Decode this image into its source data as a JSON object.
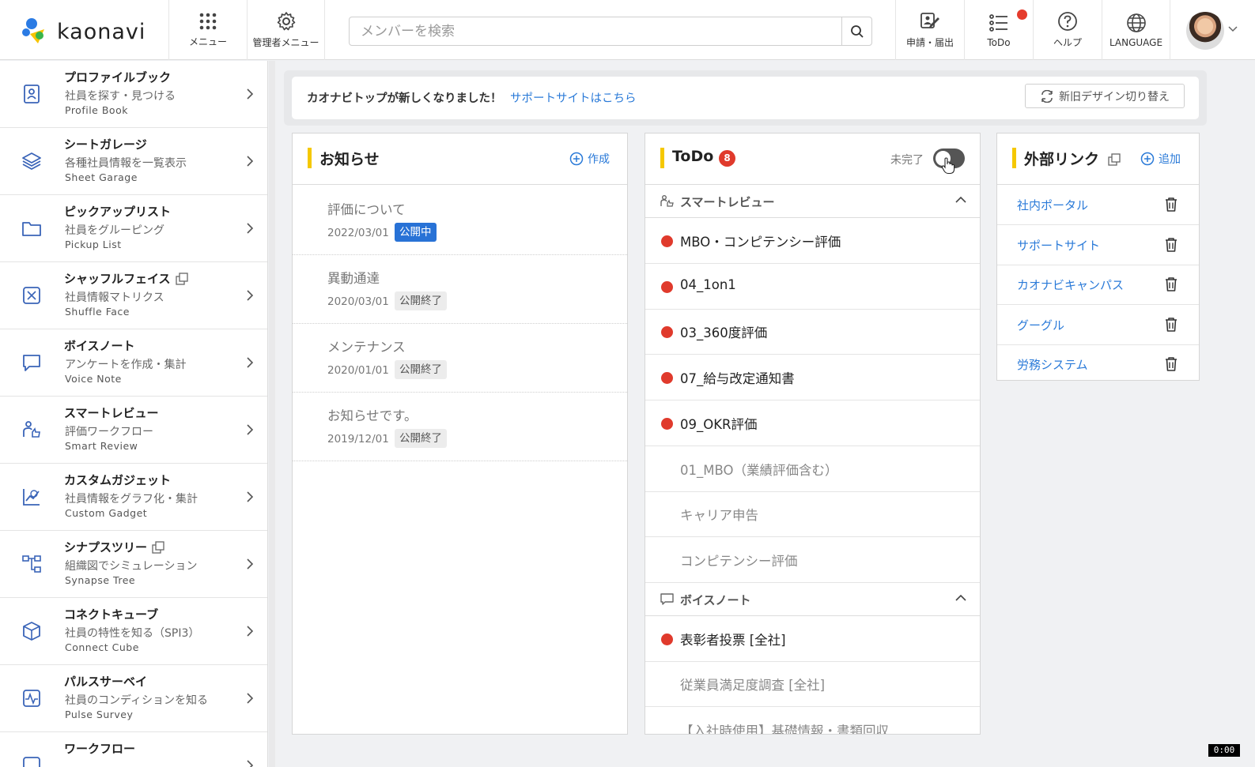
{
  "brand": {
    "name": "kaonavi"
  },
  "header": {
    "menu_label": "メニュー",
    "admin_menu_label": "管理者メニュー",
    "search_placeholder": "メンバーを検索",
    "apply_label": "申請・届出",
    "todo_label": "ToDo",
    "help_label": "ヘルプ",
    "language_label": "LANGUAGE",
    "notification_color": "#e53b2c"
  },
  "sidebar": {
    "items": [
      {
        "title": "プロファイルブック",
        "desc": "社員を探す・見つける",
        "en": "Profile Book",
        "icon": "profile-book-icon",
        "external": false
      },
      {
        "title": "シートガレージ",
        "desc": "各種社員情報を一覧表示",
        "en": "Sheet Garage",
        "icon": "layers-icon",
        "external": false
      },
      {
        "title": "ピックアップリスト",
        "desc": "社員をグルーピング",
        "en": "Pickup List",
        "icon": "folder-icon",
        "external": false
      },
      {
        "title": "シャッフルフェイス",
        "desc": "社員情報マトリクス",
        "en": "Shuffle Face",
        "icon": "shuffle-icon",
        "external": true
      },
      {
        "title": "ボイスノート",
        "desc": "アンケートを作成・集計",
        "en": "Voice Note",
        "icon": "speech-bubble-icon",
        "external": false
      },
      {
        "title": "スマートレビュー",
        "desc": "評価ワークフロー",
        "en": "Smart Review",
        "icon": "thumbs-up-person-icon",
        "external": false
      },
      {
        "title": "カスタムガジェット",
        "desc": "社員情報をグラフ化・集計",
        "en": "Custom Gadget",
        "icon": "chart-icon",
        "external": false
      },
      {
        "title": "シナプスツリー",
        "desc": "組織図でシミュレーション",
        "en": "Synapse Tree",
        "icon": "org-tree-icon",
        "external": true
      },
      {
        "title": "コネクトキューブ",
        "desc": "社員の特性を知る（SPI3）",
        "en": "Connect Cube",
        "icon": "cube-icon",
        "external": false
      },
      {
        "title": "パルスサーベイ",
        "desc": "社員のコンディションを知る",
        "en": "Pulse Survey",
        "icon": "pulse-icon",
        "external": false
      },
      {
        "title": "ワークフロー",
        "desc": "",
        "en": "",
        "icon": "workflow-icon",
        "external": false
      }
    ]
  },
  "banner": {
    "message": "カオナビトップが新しくなりました！",
    "link": "サポートサイトはこちら",
    "switch_label": "新旧デザイン切り替え"
  },
  "news": {
    "title": "お知らせ",
    "create_label": "作成",
    "items": [
      {
        "title": "評価について",
        "date": "2022/03/01",
        "status": "公開中",
        "open": true
      },
      {
        "title": "異動通達",
        "date": "2020/03/01",
        "status": "公開終了",
        "open": false
      },
      {
        "title": "メンテナンス",
        "date": "2020/01/01",
        "status": "公開終了",
        "open": false
      },
      {
        "title": "お知らせです。",
        "date": "2019/12/01",
        "status": "公開終了",
        "open": false
      }
    ]
  },
  "todo": {
    "title": "ToDo",
    "count": "8",
    "filter_label": "未完了",
    "sections": [
      {
        "title": "スマートレビュー",
        "items": [
          {
            "label": "MBO・コンピテンシー評価",
            "pending": true
          },
          {
            "label": "04_1on1",
            "pending": true
          },
          {
            "label": "03_360度評価",
            "pending": true
          },
          {
            "label": "07_給与改定通知書",
            "pending": true
          },
          {
            "label": "09_OKR評価",
            "pending": true
          },
          {
            "label": "01_MBO（業績評価含む）",
            "pending": false
          },
          {
            "label": "キャリア申告",
            "pending": false
          },
          {
            "label": "コンピテンシー評価",
            "pending": false
          }
        ]
      },
      {
        "title": "ボイスノート",
        "items": [
          {
            "label": "表彰者投票 [全社]",
            "pending": true
          },
          {
            "label": "従業員満足度調査 [全社]",
            "pending": false
          },
          {
            "label": "【入社時使用】基礎情報・書類回収",
            "pending": false
          }
        ]
      }
    ]
  },
  "links": {
    "title": "外部リンク",
    "add_label": "追加",
    "items": [
      "社内ポータル",
      "サポートサイト",
      "カオナビキャンパス",
      "グーグル",
      "労務システム"
    ]
  },
  "timer": "0:00",
  "colors": {
    "accent": "#2a7ad8",
    "yellow": "#f5c800",
    "red": "#e03a2c"
  }
}
